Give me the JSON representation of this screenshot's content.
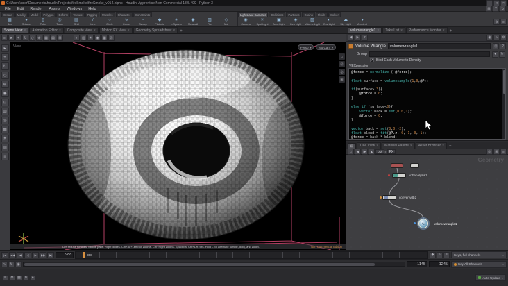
{
  "titlebar": {
    "title": "C:\\Users\\user\\Documents\\houdiniProjects\\fireSmoke\\fireSmoke_v014.hipnc - Houdini Apprentice Non-Commercial 18.5.499 - Python 3"
  },
  "menubar": {
    "items": [
      "File",
      "Edit",
      "Render",
      "Assets",
      "Windows",
      "Help"
    ]
  },
  "shelf": {
    "tabs_left": [
      "Create",
      "Modify",
      "Model",
      "Polygon",
      "Deform",
      "Texture",
      "Rigging",
      "Muscles",
      "Character",
      "Constraints"
    ],
    "tabs_right": [
      "Lights and Cameras",
      "Collisions",
      "Particles",
      "Grains",
      "Fluids",
      "Solver"
    ],
    "tools_left": [
      {
        "label": "Box",
        "glyph": "▦"
      },
      {
        "label": "Sphere",
        "glyph": "●"
      },
      {
        "label": "Tube",
        "glyph": "▯"
      },
      {
        "label": "Torus",
        "glyph": "◎"
      },
      {
        "label": "Grid",
        "glyph": "▤"
      },
      {
        "label": "Line",
        "glyph": "/"
      },
      {
        "label": "Circle",
        "glyph": "○"
      },
      {
        "label": "Curve",
        "glyph": "∿"
      },
      {
        "label": "Sweep",
        "glyph": "≈"
      },
      {
        "label": "Platonic",
        "glyph": "◆"
      },
      {
        "label": "L-System",
        "glyph": "∗"
      },
      {
        "label": "Metaball",
        "glyph": "◉"
      },
      {
        "label": "File",
        "glyph": "▥"
      },
      {
        "label": "Null",
        "glyph": "◇"
      }
    ],
    "tools_right": [
      {
        "label": "Camera",
        "glyph": "◉"
      },
      {
        "label": "Spot Light",
        "glyph": "☀"
      },
      {
        "label": "Area Light",
        "glyph": "▣"
      },
      {
        "label": "Geo Light",
        "glyph": "◈"
      },
      {
        "label": "Volume Light",
        "glyph": "▨"
      },
      {
        "label": "Env Light",
        "glyph": "◐"
      },
      {
        "label": "Sky Light",
        "glyph": "☁"
      },
      {
        "label": "Ambient",
        "glyph": "◑"
      }
    ]
  },
  "pane_tabs_left": [
    {
      "label": "Scene View",
      "active": true
    },
    {
      "label": "Animation Editor",
      "active": false
    },
    {
      "label": "Composite View",
      "active": false
    },
    {
      "label": "Motion FX View",
      "active": false
    },
    {
      "label": "Geometry Spreadsheet",
      "active": false
    }
  ],
  "pane_tabs_right": [
    {
      "label": "volumewrangle1",
      "active": true
    },
    {
      "label": "Take List",
      "active": false
    },
    {
      "label": "Performance Monitor",
      "active": false
    }
  ],
  "viewport": {
    "corner_label": "View",
    "camera_chip": "Persp",
    "cam_menu_chip": "No Cam",
    "help_text": "Left mouse tumbles.  Middle pans.  Right dollies.  Ctrl+Alt+Left box zooms.  Ctrl+Right zooms.  Spacebar Ctrl+Left tilts.  Hold L for alternate tumble, dolly, and zoom.",
    "license_text": "Non Commercial Edition",
    "bbox_color": "#e0507c"
  },
  "params": {
    "pane_title": "Volume Wrangle",
    "node_name": "volumewrangle1",
    "group_label": "Group",
    "group_value": "",
    "bind_label": "Bind Each Volume to Density",
    "vex_label": "VEXpression",
    "code_lines": [
      "@force = normalize (-@force);",
      "",
      "float surface = volumesample(1,0,@P);",
      "",
      "if(surface>.3){",
      "    @force = 0;",
      "}",
      "",
      "else if (surface<0){",
      "    vector back = set(0,0,1);",
      "    @force = 0;",
      "}",
      "",
      "vector back = set(0,0,-2);",
      "float blend = fit(@P.z, 0, 1, 0, 1);",
      "@force = back * blend;"
    ]
  },
  "network": {
    "path": [
      "obj",
      "FX"
    ],
    "tabs": [
      {
        "label": "Tree View",
        "active": false
      },
      {
        "label": "Material Palette",
        "active": false
      },
      {
        "label": "Asset Browser",
        "active": false
      }
    ],
    "watermark": "Geometry",
    "nodes": {
      "vdbanalysis": "vdbanalysis1",
      "convertvdb": "convertvdb2",
      "volumewrangle": "volumewrangle1"
    }
  },
  "playbar": {
    "transport": [
      {
        "name": "jump-start",
        "glyph": "|◀"
      },
      {
        "name": "prev-key",
        "glyph": "◀◀"
      },
      {
        "name": "prev-frame",
        "glyph": "◀"
      },
      {
        "name": "play-reverse",
        "glyph": "◁"
      },
      {
        "name": "play",
        "glyph": "▶"
      },
      {
        "name": "next-frame",
        "glyph": "▶▶"
      },
      {
        "name": "jump-end",
        "glyph": "▶|"
      }
    ],
    "current_frame": "988",
    "ruler_frame_label": "988",
    "range_start": "1145",
    "range_end": "1245",
    "channels_box": "Keys, full channels",
    "key_box": "Key All Channels",
    "update_mode": "Auto Update"
  },
  "icons": {
    "titlebar_buttons": [
      {
        "name": "minimize-button",
        "glyph": "─"
      },
      {
        "name": "maximize-button",
        "glyph": "□"
      },
      {
        "name": "close-button",
        "glyph": "×"
      }
    ],
    "menubar_right": [
      {
        "name": "layout-grid-icon",
        "glyph": "⊞"
      },
      {
        "name": "help-icon",
        "glyph": "?"
      },
      {
        "name": "refresh-icon",
        "glyph": "↻"
      }
    ],
    "shelf_right": [
      {
        "name": "shelf-gear-icon",
        "glyph": "⊛"
      },
      {
        "name": "shelf-more-icon",
        "glyph": "≡"
      }
    ],
    "viewport_toolbar_left": [
      {
        "name": "pane-menu-icon",
        "glyph": "≡"
      },
      {
        "name": "select-icon",
        "glyph": "▸"
      },
      {
        "name": "translate-icon",
        "glyph": "+"
      },
      {
        "name": "rotate-icon",
        "glyph": "↻"
      },
      {
        "name": "scale-icon",
        "glyph": "◇"
      },
      {
        "name": "handles-icon",
        "glyph": "⊕"
      },
      {
        "name": "snap-grid-icon",
        "glyph": "▦"
      },
      {
        "name": "snap-point-icon",
        "glyph": "▤"
      },
      {
        "name": "viewport-layout-icon",
        "glyph": "⊞"
      }
    ],
    "viewport_toolbar_mid": [
      {
        "name": "shading-mode-icon",
        "glyph": "◐"
      },
      {
        "name": "wireframe-icon",
        "glyph": "▧"
      },
      {
        "name": "lighting-icon",
        "glyph": "☀"
      },
      {
        "name": "camera-view-icon",
        "glyph": "◉"
      },
      {
        "name": "reference-grid-icon",
        "glyph": "▦"
      },
      {
        "name": "display-options-icon",
        "glyph": "⊡"
      }
    ],
    "viewport_right_col": [
      {
        "name": "view-home-icon",
        "glyph": "⌂"
      },
      {
        "name": "view-frame-icon",
        "glyph": "⊡"
      },
      {
        "name": "view-persp-icon",
        "glyph": "◎"
      },
      {
        "name": "view-snap-icon",
        "glyph": "⊞"
      }
    ],
    "viewport_left_strip": [
      {
        "name": "select-tool-icon",
        "glyph": "▸"
      },
      {
        "name": "move-tool-icon",
        "glyph": "+"
      },
      {
        "name": "rotate-tool-icon",
        "glyph": "↻"
      },
      {
        "name": "scale-tool-icon",
        "glyph": "◇"
      },
      {
        "name": "pose-tool-icon",
        "glyph": "⊕"
      },
      {
        "name": "view-tool-icon",
        "glyph": "◉"
      },
      {
        "name": "render-region-icon",
        "glyph": "⊡"
      },
      {
        "name": "flipbook-icon",
        "glyph": "▥"
      },
      {
        "name": "snapshot-icon",
        "glyph": "◎"
      },
      {
        "name": "grid-toggle-icon",
        "glyph": "▦"
      },
      {
        "name": "light-toggle-icon",
        "glyph": "☀"
      },
      {
        "name": "volume-display-icon",
        "glyph": "▨"
      },
      {
        "name": "display-flags-icon",
        "glyph": "≡"
      }
    ],
    "param_toolbar_left": [
      {
        "name": "back-arrow-icon",
        "glyph": "◀"
      },
      {
        "name": "forward-arrow-icon",
        "glyph": "▶"
      },
      {
        "name": "node-history-icon",
        "glyph": "▾"
      }
    ],
    "param_toolbar_right": [
      {
        "name": "pin-icon",
        "glyph": "◉"
      },
      {
        "name": "link-icon",
        "glyph": "∿"
      },
      {
        "name": "gear-icon",
        "glyph": "⊛"
      }
    ],
    "param_header_right": [
      {
        "name": "lock-icon",
        "glyph": "⊡"
      },
      {
        "name": "help-circle-icon",
        "glyph": "?"
      }
    ],
    "group_row_right": [
      {
        "name": "group-dropdown-icon",
        "glyph": "▾"
      },
      {
        "name": "group-reset-icon",
        "glyph": "↻"
      }
    ],
    "net_path_left": [
      {
        "name": "net-home-icon",
        "glyph": "⌂"
      },
      {
        "name": "net-back-icon",
        "glyph": "◀"
      },
      {
        "name": "net-forward-icon",
        "glyph": "▶"
      },
      {
        "name": "net-up-icon",
        "glyph": "▲"
      }
    ],
    "net_path_right": [
      {
        "name": "net-display-icon",
        "glyph": "◎"
      },
      {
        "name": "net-grid-icon",
        "glyph": "⊞"
      },
      {
        "name": "net-menu-icon",
        "glyph": "≡"
      }
    ],
    "playbar_misc": [
      {
        "name": "keyframe-icon",
        "glyph": "◆"
      },
      {
        "name": "audio-icon",
        "glyph": "♪"
      },
      {
        "name": "playback-options-icon",
        "glyph": "≡"
      }
    ],
    "playbar_b_left": [
      {
        "name": "anim-toggle-icon",
        "glyph": "∿"
      },
      {
        "name": "loop-icon",
        "glyph": "↻"
      },
      {
        "name": "realtime-icon",
        "glyph": "◉"
      }
    ],
    "status_left": [
      {
        "name": "message-log-icon",
        "glyph": "≡"
      },
      {
        "name": "error-badge-icon",
        "glyph": "⊗"
      },
      {
        "name": "memory-icon",
        "glyph": "▦"
      },
      {
        "name": "cook-icon",
        "glyph": "↻"
      },
      {
        "name": "status-select-icon",
        "glyph": "▸"
      }
    ]
  }
}
